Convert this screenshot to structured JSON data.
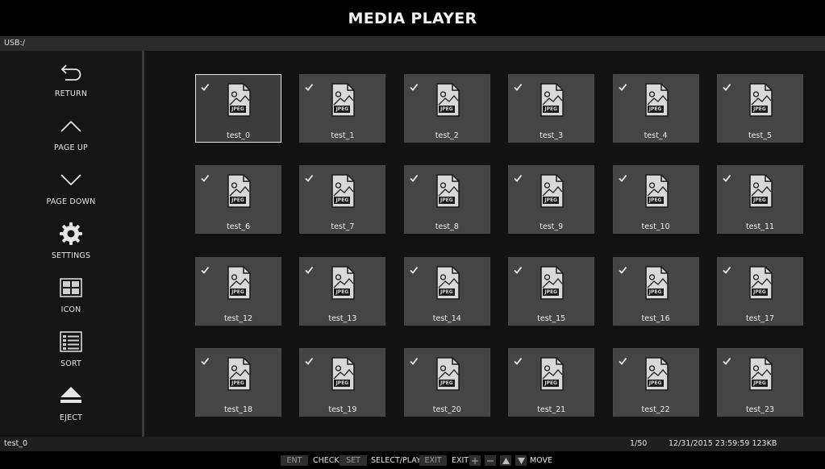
{
  "header": {
    "title": "MEDIA PLAYER"
  },
  "path": {
    "text": "USB:/"
  },
  "sidebar": {
    "items": [
      {
        "label": "RETURN",
        "icon": "return-icon"
      },
      {
        "label": "PAGE UP",
        "icon": "chevron-up-icon"
      },
      {
        "label": "PAGE DOWN",
        "icon": "chevron-down-icon"
      },
      {
        "label": "SETTINGS",
        "icon": "gear-icon"
      },
      {
        "label": "ICON",
        "icon": "grid-view-icon"
      },
      {
        "label": "SORT",
        "icon": "sort-list-icon"
      },
      {
        "label": "EJECT",
        "icon": "eject-icon"
      }
    ]
  },
  "files": {
    "type_label": "JPEG",
    "selected_index": 0,
    "items": [
      {
        "name": "test_0",
        "checked": true
      },
      {
        "name": "test_1",
        "checked": true
      },
      {
        "name": "test_2",
        "checked": true
      },
      {
        "name": "test_3",
        "checked": true
      },
      {
        "name": "test_4",
        "checked": true
      },
      {
        "name": "test_5",
        "checked": true
      },
      {
        "name": "test_6",
        "checked": true
      },
      {
        "name": "test_7",
        "checked": true
      },
      {
        "name": "test_8",
        "checked": true
      },
      {
        "name": "test_9",
        "checked": true
      },
      {
        "name": "test_10",
        "checked": true
      },
      {
        "name": "test_11",
        "checked": true
      },
      {
        "name": "test_12",
        "checked": true
      },
      {
        "name": "test_13",
        "checked": true
      },
      {
        "name": "test_14",
        "checked": true
      },
      {
        "name": "test_15",
        "checked": true
      },
      {
        "name": "test_16",
        "checked": true
      },
      {
        "name": "test_17",
        "checked": true
      },
      {
        "name": "test_18",
        "checked": true
      },
      {
        "name": "test_19",
        "checked": true
      },
      {
        "name": "test_20",
        "checked": true
      },
      {
        "name": "test_21",
        "checked": true
      },
      {
        "name": "test_22",
        "checked": true
      },
      {
        "name": "test_23",
        "checked": true
      }
    ]
  },
  "status": {
    "current_file": "test_0",
    "page": "1/50",
    "info": "12/31/2015 23:59:59 123KB"
  },
  "help": {
    "ent_key": "ENT",
    "ent_action": "CHECK",
    "set_key": "SET",
    "set_action": "SELECT/PLAY",
    "exit_key": "EXIT",
    "exit_action": "EXIT",
    "move_action": "MOVE"
  },
  "colors": {
    "tile": "#454545",
    "selected_border": "#e8e8e8",
    "background": "#121212"
  }
}
